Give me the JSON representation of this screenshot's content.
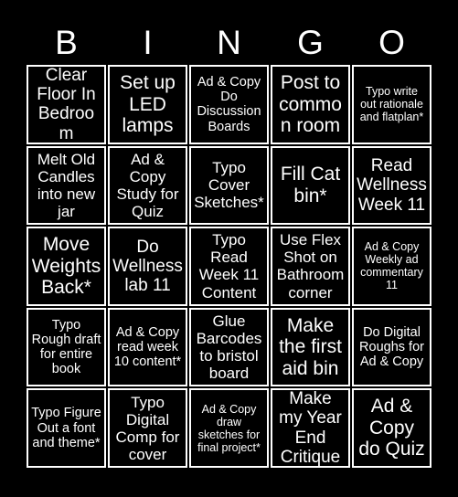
{
  "card": {
    "header_letters": [
      "B",
      "I",
      "N",
      "G",
      "O"
    ],
    "background_color": "#000000",
    "text_color": "#ffffff",
    "border_color": "#ffffff",
    "grid_size": "5x5"
  },
  "grid": {
    "rows": [
      [
        {
          "text": "Clear Floor In Bedroom",
          "size": "lg"
        },
        {
          "text": "Set up LED lamps",
          "size": "xl"
        },
        {
          "text": "Ad & Copy Do Discussion Boards",
          "size": "sm"
        },
        {
          "text": "Post to common room",
          "size": "xl"
        },
        {
          "text": "Typo write out rationale and flatplan*",
          "size": "xs"
        }
      ],
      [
        {
          "text": "Melt Old Candles into new jar",
          "size": "md"
        },
        {
          "text": "Ad & Copy Study for Quiz",
          "size": "md"
        },
        {
          "text": "Typo Cover Sketches*",
          "size": "md"
        },
        {
          "text": "Fill Cat bin*",
          "size": "xl"
        },
        {
          "text": "Read Wellness Week 11",
          "size": "lg"
        }
      ],
      [
        {
          "text": "Move Weights Back*",
          "size": "xl"
        },
        {
          "text": "Do Wellness lab 11",
          "size": "lg"
        },
        {
          "text": "Typo Read Week 11 Content",
          "size": "md"
        },
        {
          "text": "Use Flex Shot on Bathroom corner",
          "size": "md"
        },
        {
          "text": "Ad & Copy Weekly ad commentary 11",
          "size": "xs"
        }
      ],
      [
        {
          "text": "Typo Rough draft for entire book",
          "size": "sm"
        },
        {
          "text": "Ad & Copy read week 10 content*",
          "size": "sm"
        },
        {
          "text": "Glue Barcodes to bristol board",
          "size": "md"
        },
        {
          "text": "Make the first aid bin",
          "size": "xl"
        },
        {
          "text": "Do Digital Roughs for Ad & Copy",
          "size": "sm"
        }
      ],
      [
        {
          "text": "Typo Figure Out a font and theme*",
          "size": "sm"
        },
        {
          "text": "Typo Digital Comp for cover",
          "size": "md"
        },
        {
          "text": "Ad & Copy draw sketches for final project*",
          "size": "xs"
        },
        {
          "text": "Make my Year End Critique",
          "size": "lg"
        },
        {
          "text": "Ad & Copy do Quiz",
          "size": "xl"
        }
      ]
    ]
  }
}
